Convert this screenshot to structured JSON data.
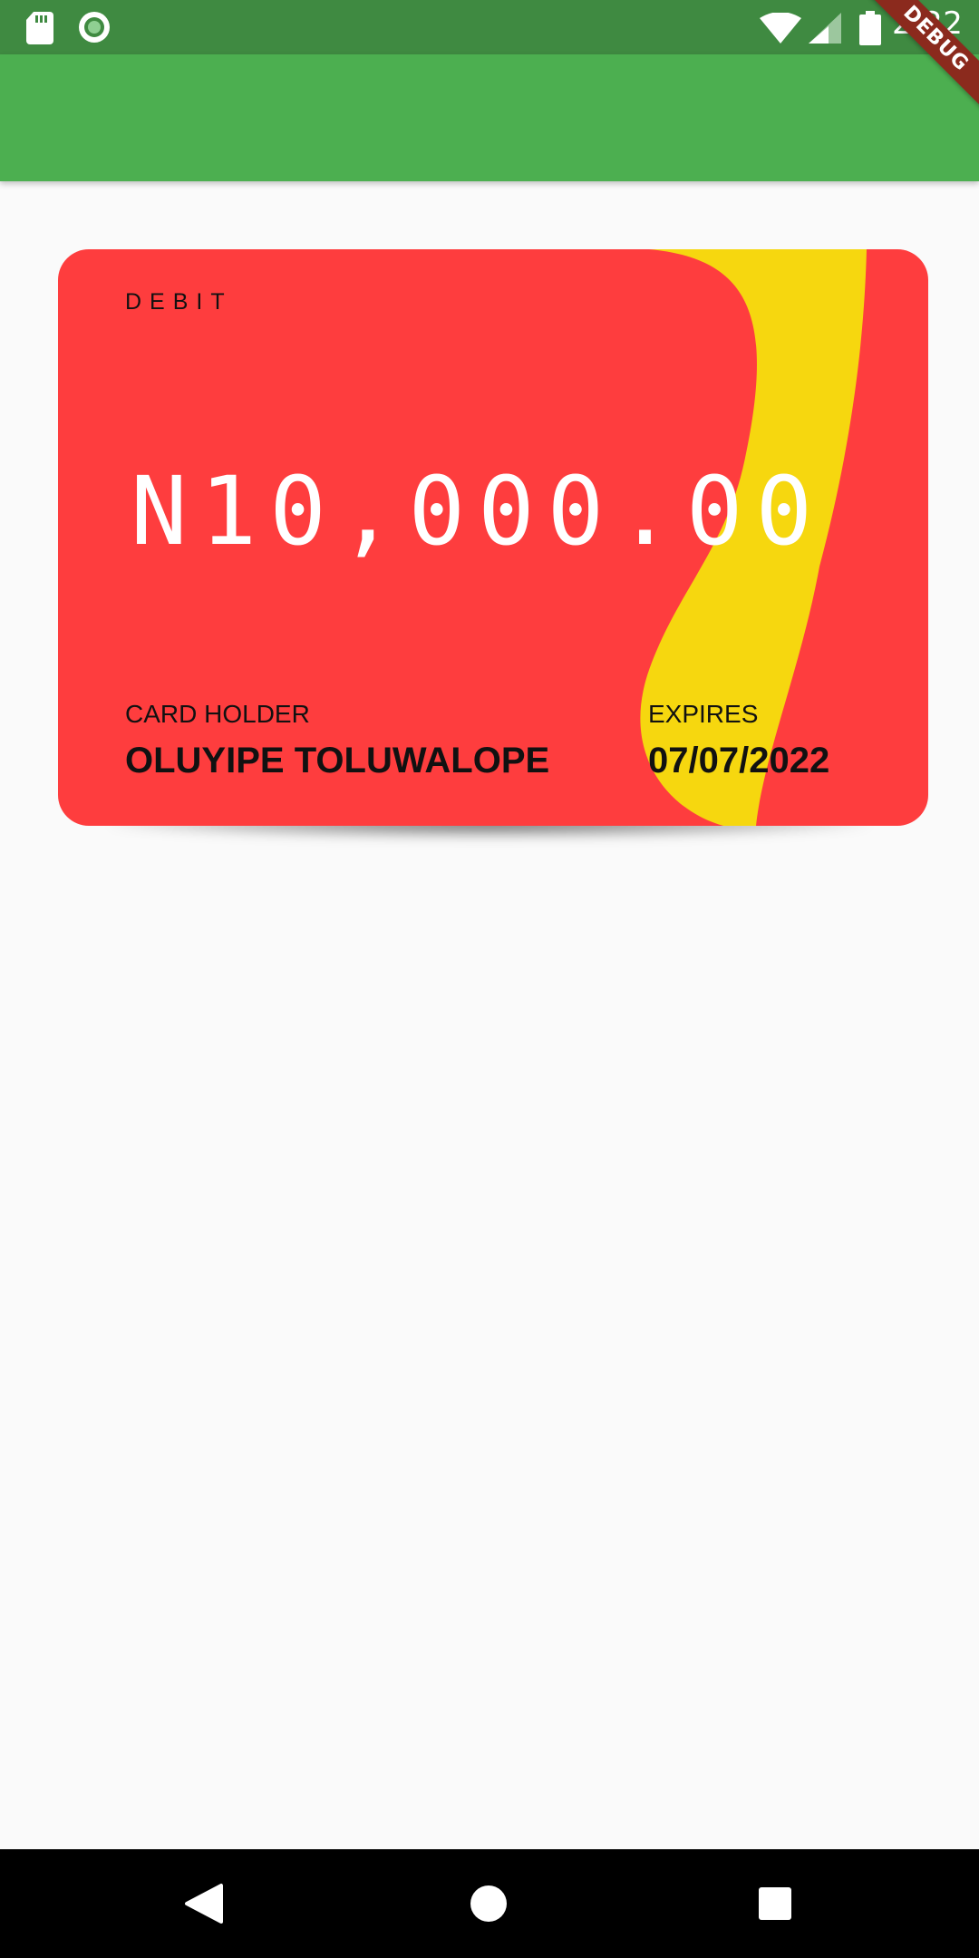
{
  "status_bar": {
    "time": "2:22",
    "icons": [
      "sd-card-icon",
      "sync-icon",
      "wifi-icon",
      "signal-icon",
      "battery-icon"
    ],
    "background": "#3f8a41"
  },
  "debug_banner": {
    "label": "DEBUG",
    "color": "#8b2a1d"
  },
  "app_bar": {
    "background": "#4caf50"
  },
  "card": {
    "type_label": "DEBIT",
    "amount": "N10,000.00",
    "holder_label": "CARD HOLDER",
    "holder_name": "OLUYIPE TOLUWALOPE",
    "expires_label": "EXPIRES",
    "expires_value": "07/07/2022",
    "colors": {
      "background": "#fe3d3e",
      "wave": "#f6d70f",
      "amount_text": "#ffffff"
    }
  },
  "nav_bar": {
    "buttons": [
      "back-icon",
      "home-icon",
      "recents-icon"
    ]
  }
}
